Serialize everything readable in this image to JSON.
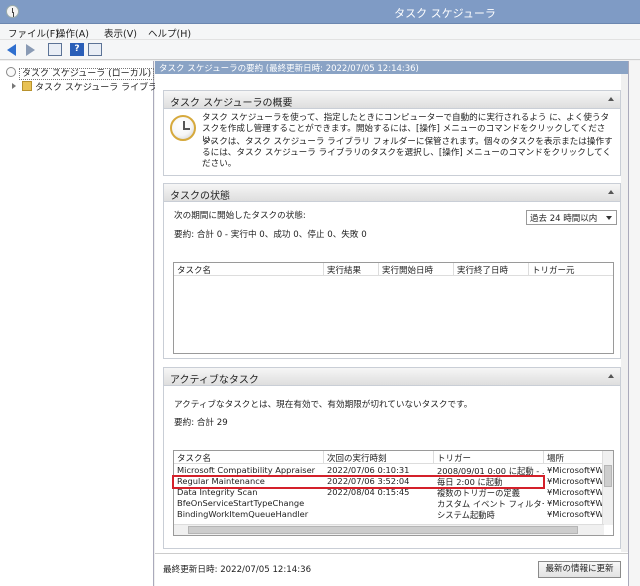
{
  "window": {
    "title": "タスク スケジューラ"
  },
  "menu": [
    "ファイル(F)",
    "操作(A)",
    "表示(V)",
    "ヘルプ(H)"
  ],
  "tree": {
    "root": "タスク スケジューラ (ローカル)",
    "child": "タスク スケジューラ ライブラリ"
  },
  "summary_header": "タスク スケジューラの要約 (最終更新日時: 2022/07/05 12:14:36)",
  "overview": {
    "title": "タスク スケジューラの概要",
    "p1": "タスク スケジューラを使って、指定したときにコンピューターで自動的に実行されるよう に、よく使うタスクを作成し管理することができます。開始するには、[操作] メニューのコマンドをクリックしてください。",
    "p2": "タスクは、タスク スケジューラ ライブラリ フォルダーに保管されます。個々のタスクを表示または操作するには、タスク スケジューラ ライブラリのタスクを選択し、[操作] メニューのコマンドをクリックしてください。"
  },
  "status": {
    "title": "タスクの状態",
    "label": "次の期間に開始したタスクの状態:",
    "period": "過去 24 時間以内",
    "summary": "要約: 合計 0 - 実行中 0、成功 0、停止 0、失敗 0",
    "columns": [
      "タスク名",
      "実行結果",
      "実行開始日時",
      "実行終了日時",
      "トリガー元"
    ]
  },
  "active": {
    "title": "アクティブなタスク",
    "desc": "アクティブなタスクとは、現在有効で、有効期限が切れていないタスクです。",
    "summary": "要約: 合計 29",
    "columns": [
      "タスク名",
      "次回の実行時刻",
      "トリガー",
      "場所"
    ],
    "rows": [
      [
        "Microsoft Compatibility Appraiser",
        "2022/07/06 0:10:31",
        "2008/09/01 0:00 に起動 - ...",
        "¥Microsoft¥W"
      ],
      [
        "Regular Maintenance",
        "2022/07/06 3:52:04",
        "毎日 2:00 に起動",
        "¥Microsoft¥W"
      ],
      [
        "Data Integrity Scan",
        "2022/08/04 0:15:45",
        "複数のトリガーの定義",
        "¥Microsoft¥W"
      ],
      [
        "BfeOnServiceStartTypeChange",
        "",
        "カスタム イベント フィルター",
        "¥Microsoft¥W"
      ],
      [
        "BindingWorkItemQueueHandler",
        "",
        "システム起動時",
        "¥Microsoft¥W"
      ]
    ]
  },
  "footer": {
    "last_updated": "最終更新日時: 2022/07/05 12:14:36",
    "refresh": "最新の情報に更新"
  },
  "colors": {
    "titlebar": "#7f9bc5",
    "highlight": "#d4202a",
    "header": "#8aa3c5"
  }
}
